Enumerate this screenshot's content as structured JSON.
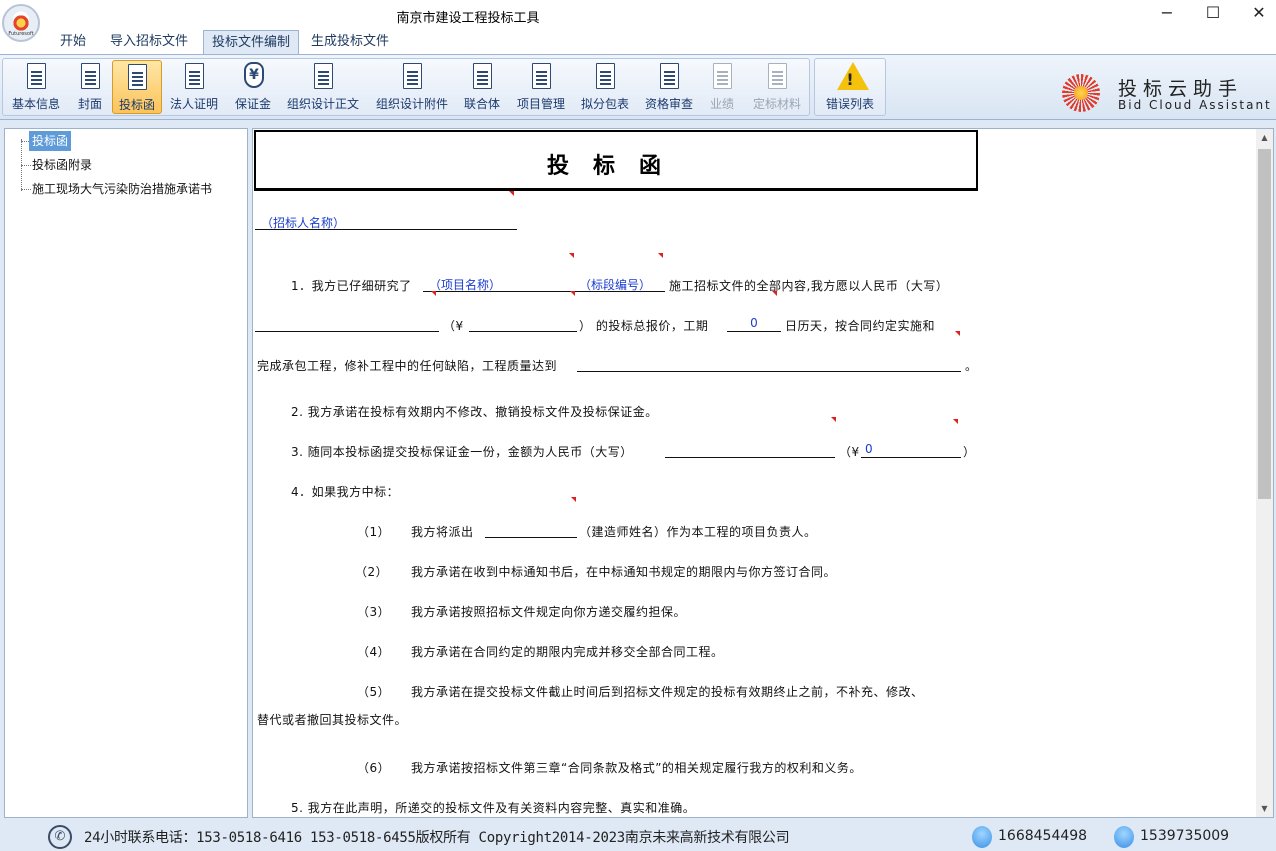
{
  "window": {
    "title": "南京市建设工程投标工具",
    "minimize": "−",
    "maximize": "☐",
    "close": "✕",
    "logo_text": "Futuresoft"
  },
  "menu": {
    "tabs": [
      "开始",
      "导入招标文件",
      "投标文件编制",
      "生成投标文件"
    ],
    "active": "投标文件编制"
  },
  "ribbon": {
    "buttons": [
      {
        "label": "基本信息",
        "icon": "document-icon"
      },
      {
        "label": "封面",
        "icon": "image-document-icon"
      },
      {
        "label": "投标函",
        "icon": "letter-icon",
        "active": true
      },
      {
        "label": "法人证明",
        "icon": "id-document-icon"
      },
      {
        "label": "保证金",
        "icon": "yuan-shield-icon"
      },
      {
        "label": "组织设计正文",
        "icon": "letter-a-document-icon"
      },
      {
        "label": "组织设计附件",
        "icon": "attachment-document-icon"
      },
      {
        "label": "联合体",
        "icon": "joint-icon"
      },
      {
        "label": "项目管理",
        "icon": "org-chart-icon"
      },
      {
        "label": "拟分包表",
        "icon": "table-icon"
      },
      {
        "label": "资格审查",
        "icon": "person-document-icon"
      },
      {
        "label": "业绩",
        "icon": "trophy-icon",
        "disabled": true
      },
      {
        "label": "定标材料",
        "icon": "document-gear-icon",
        "disabled": true
      },
      {
        "label": "错误列表",
        "icon": "warning-icon"
      }
    ]
  },
  "brand": {
    "name_cn": "投标云助手",
    "name_en": "Bid Cloud Assistant"
  },
  "tree": {
    "items": [
      "投标函",
      "投标函附录",
      "施工现场大气污染防治措施承诺书"
    ],
    "selected": "投标函"
  },
  "document": {
    "title": "投标函",
    "recipient_placeholder": "（招标人名称）",
    "p1_prefix": "1．我方已仔细研究了",
    "p1_project_name": "（项目名称）",
    "p1_section_no": "（标段编号）",
    "p1_suffix": "施工招标文件的全部内容,我方愿以人民币（大写）",
    "p1_line2_a": "（¥",
    "p1_line2_b": "）   的投标总报价，工期",
    "p1_duration": "0",
    "p1_line2_c": "日历天，按合同约定实施和",
    "p1_line3_a": "完成承包工程，修补工程中的任何缺陷，工程质量达到",
    "p1_line3_end": "。",
    "p2": "2.  我方承诺在投标有效期内不修改、撤销投标文件及投标保证金。",
    "p3_a": "3.  随同本投标函提交投标保证金一份，金额为人民币（大写）",
    "p3_b": "（¥",
    "p3_amount": "0",
    "p3_c": "）",
    "p4": "4．如果我方中标：",
    "p4_1_num": "（1）",
    "p4_1_a": "我方将派出",
    "p4_1_b": "（建造师姓名）作为本工程的项目负责人。",
    "p4_2_num": "（2）",
    "p4_2": "我方承诺在收到中标通知书后，在中标通知书规定的期限内与你方签订合同。",
    "p4_3_num": "（3）",
    "p4_3": "我方承诺按照招标文件规定向你方递交履约担保。",
    "p4_4_num": "（4）",
    "p4_4": "我方承诺在合同约定的期限内完成并移交全部合同工程。",
    "p4_5_num": "（5）",
    "p4_5_a": "我方承诺在提交投标文件截止时间后到招标文件规定的投标有效期终止之前，不补充、修改、",
    "p4_5_b": "替代或者撤回其投标文件。",
    "p4_6_num": "（6）",
    "p4_6": "我方承诺按招标文件第三章“合同条款及格式”的相关规定履行我方的权利和义务。",
    "p5": "5.  我方在此声明，所递交的投标文件及有关资料内容完整、真实和准确。"
  },
  "scrollbar": {
    "up": "▲",
    "down": "▼"
  },
  "status": {
    "text": "24小时联系电话：153-0518-6416 153-0518-6455版权所有 Copyright2014-2023南京未来高新技术有限公司",
    "qq1": "1668454498",
    "qq2": "1539735009",
    "phone_glyph": "✆"
  }
}
